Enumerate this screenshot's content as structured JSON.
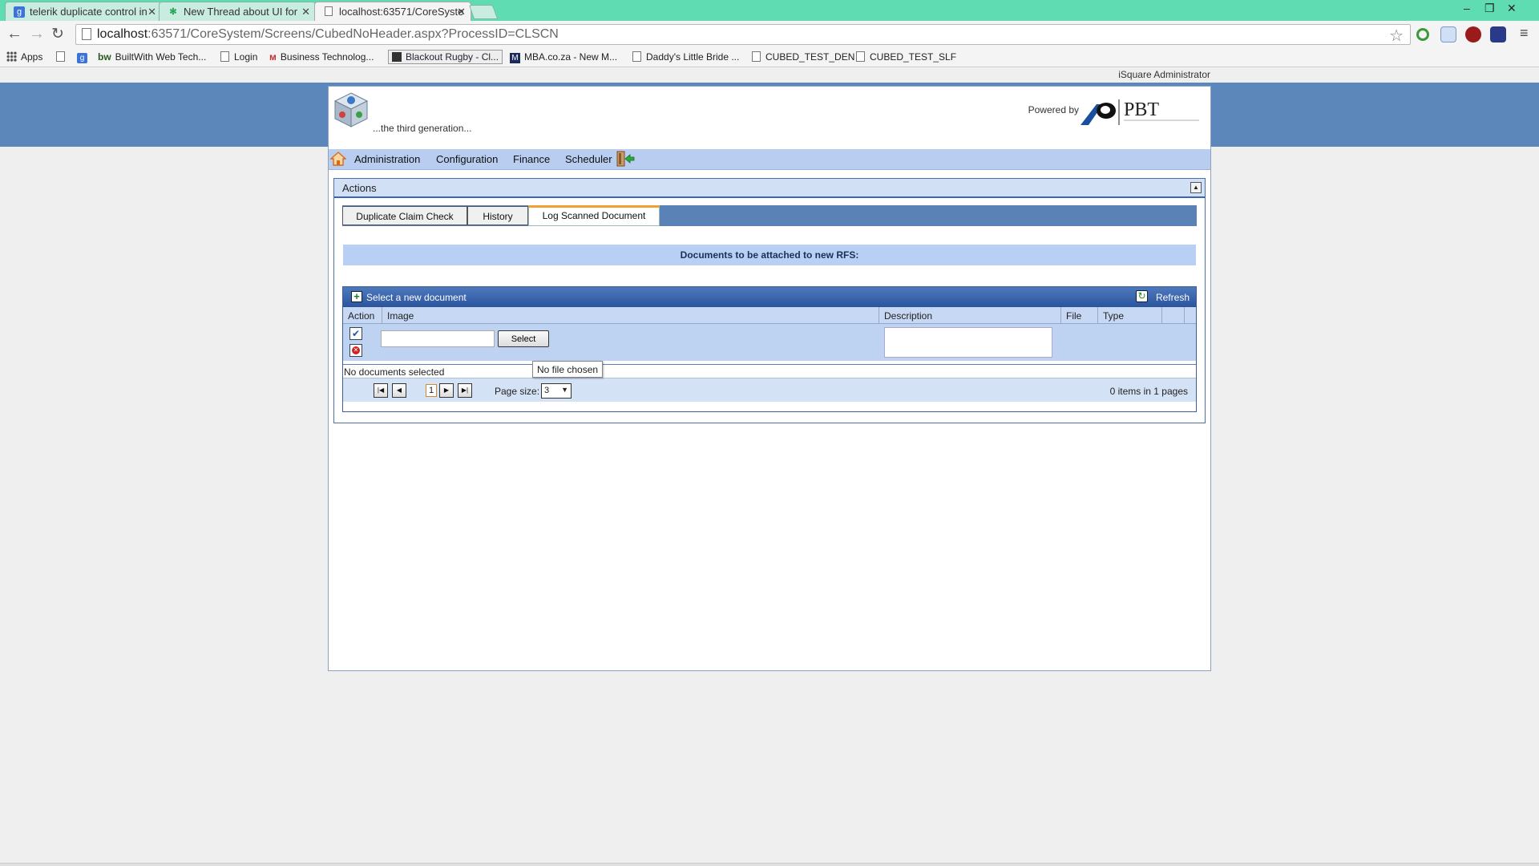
{
  "browser": {
    "tabs": [
      {
        "title": "telerik duplicate control in",
        "active": false
      },
      {
        "title": "New Thread about UI for",
        "active": false
      },
      {
        "title": "localhost:63571/CoreSyste",
        "active": true
      }
    ],
    "url_host": "localhost",
    "url_rest": ":63571/CoreSystem/Screens/CubedNoHeader.aspx?ProcessID=CLSCN",
    "bookmarks": [
      "Apps",
      "BuiltWith Web Tech...",
      "Login",
      "Business Technolog...",
      "Blackout Rugby - Cl...",
      "MBA.co.za - New M...",
      "Daddy's Little Bride ...",
      "CUBED_TEST_DEN",
      "CUBED_TEST_SLF"
    ]
  },
  "page": {
    "user": "iSquare Administrator",
    "tagline": "...the third generation...",
    "powered_by": "Powered by",
    "brand": "PBT",
    "menu": [
      "Administration",
      "Configuration",
      "Finance",
      "Scheduler"
    ],
    "actions_title": "Actions",
    "tabs": [
      "Duplicate Claim Check",
      "History",
      "Log Scanned Document"
    ],
    "active_tab": "Log Scanned Document",
    "banner": "Documents to be attached to new RFS:",
    "grid": {
      "select_new": "Select a new document",
      "refresh": "Refresh",
      "columns": [
        "Action",
        "Image",
        "Description",
        "File",
        "Type"
      ],
      "select_button": "Select",
      "file_tooltip": "No file chosen",
      "no_docs": "No documents selected",
      "pager": {
        "page": "1",
        "page_size_label": "Page size:",
        "page_size": "3",
        "info": "0 items in 1 pages"
      }
    }
  },
  "colors": {
    "chrome_accent": "#5fdcb1",
    "header_band": "#5b87ba",
    "menu_bar": "#b8cdf0",
    "grid_header": "#2b56a0"
  },
  "icons": [
    "google-favicon",
    "telerik-favicon",
    "page-icon",
    "back-icon",
    "forward-icon",
    "reload-icon",
    "star-icon",
    "home-icon",
    "exit-icon",
    "collapse-icon",
    "plus-icon",
    "refresh-icon",
    "check-icon",
    "delete-icon"
  ]
}
